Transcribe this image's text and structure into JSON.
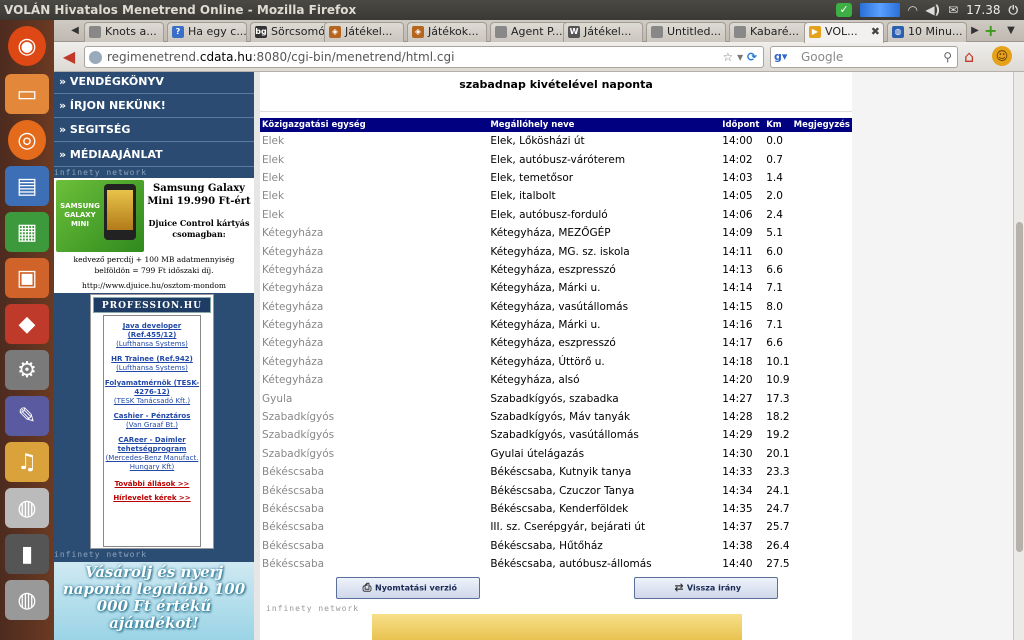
{
  "window": {
    "title": "VOLÁN Hivatalos Menetrend Online - Mozilla Firefox",
    "time": "17.38"
  },
  "tabs": [
    {
      "label": "Knots a...",
      "icon": "tab-icon",
      "color": "#888"
    },
    {
      "label": "Ha egy c...",
      "icon": "help-icon",
      "color": "#3a6fc8"
    },
    {
      "label": "Sörcsomó",
      "icon": "bg-logo-icon",
      "color": "#333"
    },
    {
      "label": "Játékel...",
      "icon": "game-icon",
      "color": "#b5651d"
    },
    {
      "label": "Játékok...",
      "icon": "game-icon",
      "color": "#b5651d"
    },
    {
      "label": "Agent P...",
      "icon": "tab-icon",
      "color": "#888"
    },
    {
      "label": "Játékel...",
      "icon": "wiki-icon",
      "color": "#555"
    },
    {
      "label": "Untitled...",
      "icon": "tab-icon",
      "color": "#888"
    },
    {
      "label": "Kabaré...",
      "icon": "tab-icon",
      "color": "#888"
    },
    {
      "label": "VOL...",
      "icon": "volan-icon",
      "color": "#e3a21a"
    },
    {
      "label": "10 Minu...",
      "icon": "globe-icon",
      "color": "#2d5fb0"
    }
  ],
  "url": {
    "host": "regimenetrend.",
    "domain": "cdata.hu",
    "rest": ":8080/cgi-bin/menetrend/html.cgi"
  },
  "search": {
    "placeholder": "Google"
  },
  "left_menu": [
    "» VENDÉGKÖNYV",
    "» ÍRJON NEKÜNK!",
    "» SEGITSÉG",
    "» MÉDIAAJÁNLAT"
  ],
  "infinety": "infinety network",
  "ad": {
    "phone_tag": "SAMSUNG GALAXY MINI",
    "title": "Samsung Galaxy Mini 19.990 Ft-ért",
    "sub": "Djuice Control kártyás csomagban:",
    "body": "kedvező percdíj + 100 MB adatmennyiség belföldön = 799 Ft időszaki díj.",
    "url": "http://www.djuice.hu/osztom-mondom"
  },
  "jobs": {
    "header": "PROFESSION.HU",
    "items": [
      {
        "title": "Java developer (Ref.455/12)",
        "company": "(Lufthansa Systems)"
      },
      {
        "title": "HR Trainee (Ref.942)",
        "company": "(Lufthansa Systems)"
      },
      {
        "title": "Folyamatmérnök (TESK-4276-12)",
        "company": "(TESK Tanácsadó Kft.)"
      },
      {
        "title": "Cashier - Pénztáros",
        "company": "(Van Graaf Bt.)"
      },
      {
        "title": "CAReer - Daimler tehetségprogram",
        "company": "(Mercedes-Benz Manufact. Hungary Kft)"
      }
    ],
    "more": "További állások >>",
    "newsletter": "Hírlevelet kérek >>"
  },
  "banner": "Vásárolj és nyerj naponta legalább 100 000 Ft értékű ajándékot!",
  "main": {
    "heading": "szabadnap kivételével naponta",
    "columns": [
      "Közigazgatási egység",
      "Megállóhely neve",
      "Időpont",
      "Km",
      "Megjegyzés"
    ],
    "rows": [
      [
        "Elek",
        "Elek, Lőkösházi út",
        "14:00",
        "0.0"
      ],
      [
        "Elek",
        "Elek, autóbusz-váróterem",
        "14:02",
        "0.7"
      ],
      [
        "Elek",
        "Elek, temetősor",
        "14:03",
        "1.4"
      ],
      [
        "Elek",
        "Elek, italbolt",
        "14:05",
        "2.0"
      ],
      [
        "Elek",
        "Elek, autóbusz-forduló",
        "14:06",
        "2.4"
      ],
      [
        "Kétegyháza",
        "Kétegyháza, MEZŐGÉP",
        "14:09",
        "5.1"
      ],
      [
        "Kétegyháza",
        "Kétegyháza, MG. sz. iskola",
        "14:11",
        "6.0"
      ],
      [
        "Kétegyháza",
        "Kétegyháza, eszpresszó",
        "14:13",
        "6.6"
      ],
      [
        "Kétegyháza",
        "Kétegyháza, Márki u.",
        "14:14",
        "7.1"
      ],
      [
        "Kétegyháza",
        "Kétegyháza, vasútállomás",
        "14:15",
        "8.0"
      ],
      [
        "Kétegyháza",
        "Kétegyháza, Márki u.",
        "14:16",
        "7.1"
      ],
      [
        "Kétegyháza",
        "Kétegyháza, eszpresszó",
        "14:17",
        "6.6"
      ],
      [
        "Kétegyháza",
        "Kétegyháza, Úttörő u.",
        "14:18",
        "10.1"
      ],
      [
        "Kétegyháza",
        "Kétegyháza, alsó",
        "14:20",
        "10.9"
      ],
      [
        "Gyula",
        "Szabadkígyós, szabadka",
        "14:27",
        "17.3"
      ],
      [
        "Szabadkígyós",
        "Szabadkígyós, Máv tanyák",
        "14:28",
        "18.2"
      ],
      [
        "Szabadkígyós",
        "Szabadkígyós, vasútállomás",
        "14:29",
        "19.2"
      ],
      [
        "Szabadkígyós",
        "Gyulai útelágazás",
        "14:30",
        "20.1"
      ],
      [
        "Békéscsaba",
        "Békéscsaba, Kutnyik tanya",
        "14:33",
        "23.3"
      ],
      [
        "Békéscsaba",
        "Békéscsaba, Czuczor Tanya",
        "14:34",
        "24.1"
      ],
      [
        "Békéscsaba",
        "Békéscsaba, Kenderföldek",
        "14:35",
        "24.7"
      ],
      [
        "Békéscsaba",
        "III. sz. Cserépgyár, bejárati út",
        "14:37",
        "25.7"
      ],
      [
        "Békéscsaba",
        "Békéscsaba, Hűtőház",
        "14:38",
        "26.4"
      ],
      [
        "Békéscsaba",
        "Békéscsaba, autóbusz-állomás",
        "14:40",
        "27.5"
      ]
    ],
    "print_button": "Nyomtatási verzió",
    "back_button": "Vissza irány"
  }
}
